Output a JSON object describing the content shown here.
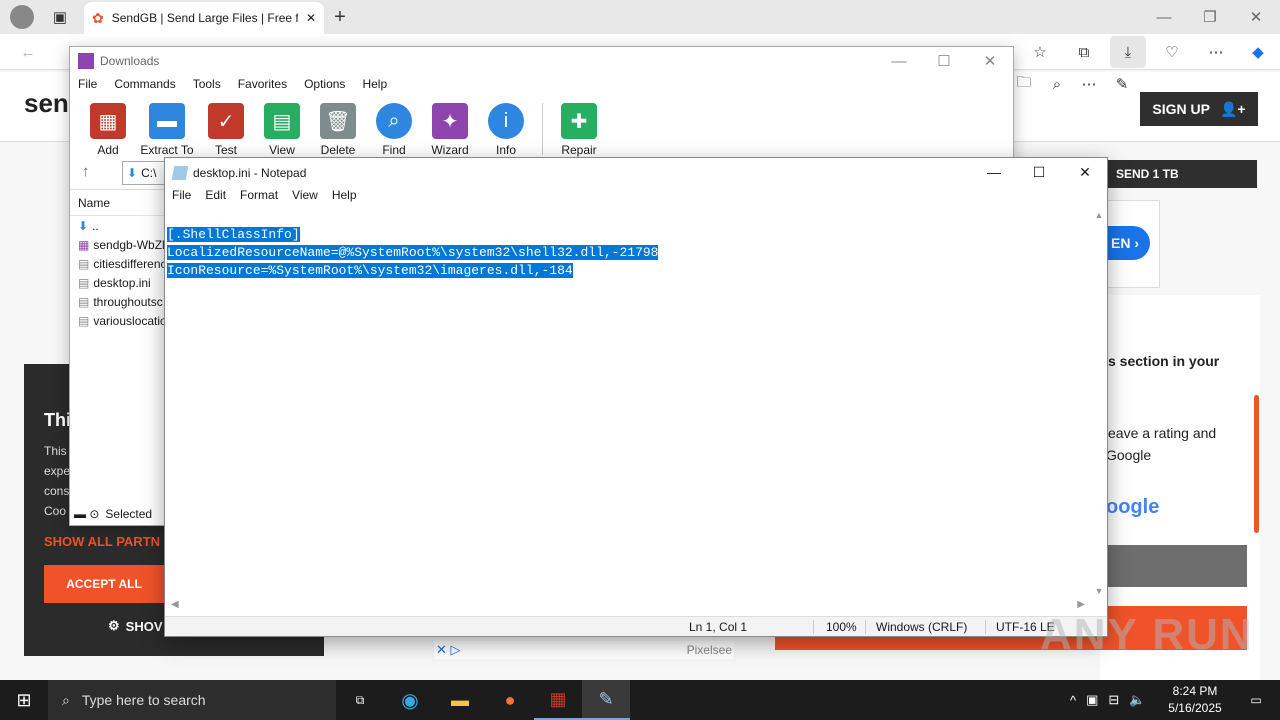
{
  "browser": {
    "tab_title": "SendGB | Send Large Files | Free f",
    "colors": {
      "accent": "#f0532a",
      "dark": "#2f2f2f"
    }
  },
  "site": {
    "logo": "sen",
    "signup": "SIGN UP",
    "send_1tb": "SEND 1 TB",
    "en": "EN",
    "panel_lines": [
      "s section in your",
      "eave a rating and",
      "Google",
      "oogle"
    ],
    "cookie": {
      "title": "Thi",
      "lines": [
        "This",
        "expe",
        "cons",
        "Coo"
      ],
      "show_partners": "SHOW ALL PARTN",
      "accept": "ACCEPT ALL",
      "show": "SHOV"
    },
    "ad": {
      "label": "Pixelsee"
    }
  },
  "winrar": {
    "title": "Downloads",
    "menu": [
      "File",
      "Commands",
      "Tools",
      "Favorites",
      "Options",
      "Help"
    ],
    "tools": [
      {
        "label": "Add",
        "icon": "add-archive-icon",
        "color": "#c0392b"
      },
      {
        "label": "Extract To",
        "icon": "extract-folder-icon",
        "color": "#2e86de"
      },
      {
        "label": "Test",
        "icon": "test-clipboard-icon",
        "color": "#c0392b"
      },
      {
        "label": "View",
        "icon": "view-book-icon",
        "color": "#27ae60"
      },
      {
        "label": "Delete",
        "icon": "trash-icon",
        "color": "#7f8c8d"
      },
      {
        "label": "Find",
        "icon": "magnifier-icon",
        "color": "#2e86de"
      },
      {
        "label": "Wizard",
        "icon": "wand-icon",
        "color": "#8e44ad"
      },
      {
        "label": "Info",
        "icon": "info-icon",
        "color": "#2e86de"
      },
      {
        "label": "Repair",
        "icon": "repair-book-icon",
        "color": "#27ae60"
      }
    ],
    "path": "C:\\",
    "column_name": "Name",
    "files": [
      "..",
      "sendgb-WbZl",
      "citiesdifferenc",
      "desktop.ini",
      "throughoutsc",
      "variouslocatio"
    ],
    "status": "Selected"
  },
  "notepad": {
    "title": "desktop.ini - Notepad",
    "menu": [
      "File",
      "Edit",
      "Format",
      "View",
      "Help"
    ],
    "lines": [
      "[.ShellClassInfo]",
      "LocalizedResourceName=@%SystemRoot%\\system32\\shell32.dll,-21798",
      "IconResource=%SystemRoot%\\system32\\imageres.dll,-184"
    ],
    "status": {
      "position": "Ln 1, Col 1",
      "zoom": "100%",
      "line_ending": "Windows (CRLF)",
      "encoding": "UTF-16 LE"
    }
  },
  "taskbar": {
    "search_placeholder": "Type here to search",
    "time": "8:24 PM",
    "date": "5/16/2025"
  },
  "watermark": "ANY RUN"
}
